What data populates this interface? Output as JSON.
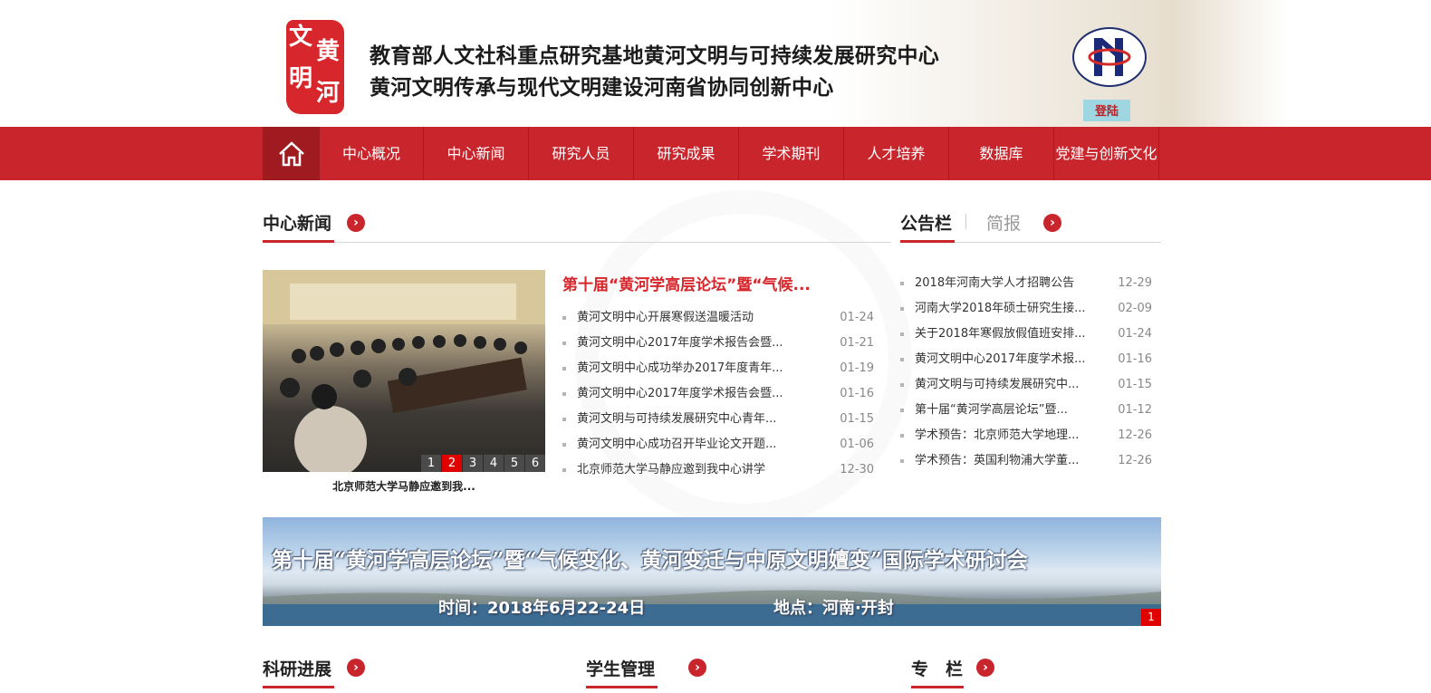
{
  "header": {
    "seal_chars": [
      "文",
      "黄",
      "明",
      "河"
    ],
    "title_line1": "教育部人文社科重点研究基地黄河文明与可持续发展研究中心",
    "title_line2": "黄河文明传承与现代文明建设河南省协同创新中心",
    "login_label": "登陆"
  },
  "nav": {
    "items": [
      "中心概况",
      "中心新闻",
      "研究人员",
      "研究成果",
      "学术期刊",
      "人才培养",
      "数据库",
      "党建与创新文化"
    ]
  },
  "news": {
    "title": "中心新闻",
    "headline": "第十届“黄河学高层论坛”暨“气候...",
    "pager": [
      "1",
      "2",
      "3",
      "4",
      "5",
      "6"
    ],
    "active_page": "2",
    "photo_caption": "北京师范大学马静应邀到我...",
    "items": [
      {
        "title": "黄河文明中心开展寒假送温暖活动",
        "date": "01-24"
      },
      {
        "title": "黄河文明中心2017年度学术报告会暨...",
        "date": "01-21"
      },
      {
        "title": "黄河文明中心成功举办2017年度青年...",
        "date": "01-19"
      },
      {
        "title": "黄河文明中心2017年度学术报告会暨...",
        "date": "01-16"
      },
      {
        "title": "黄河文明与可持续发展研究中心青年...",
        "date": "01-15"
      },
      {
        "title": "黄河文明中心成功召开毕业论文开题...",
        "date": "01-06"
      },
      {
        "title": "北京师范大学马静应邀到我中心讲学",
        "date": "12-30"
      }
    ]
  },
  "notice": {
    "tab_active": "公告栏",
    "tab_inactive": "简报",
    "items": [
      {
        "title": "2018年河南大学人才招聘公告",
        "date": "12-29"
      },
      {
        "title": "河南大学2018年硕士研究生接...",
        "date": "02-09"
      },
      {
        "title": "关于2018年寒假放假值班安排...",
        "date": "01-24"
      },
      {
        "title": "黄河文明中心2017年度学术报...",
        "date": "01-16"
      },
      {
        "title": "黄河文明与可持续发展研究中...",
        "date": "01-15"
      },
      {
        "title": "第十届“黄河学高层论坛”暨...",
        "date": "01-12"
      },
      {
        "title": "学术预告：北京师范大学地理...",
        "date": "12-26"
      },
      {
        "title": "学术预告：英国利物浦大学董...",
        "date": "12-26"
      }
    ]
  },
  "banner": {
    "title": "第十届“黄河学高层论坛”暨“气候变化、黄河变迁与中原文明嬗变”国际学术研讨会",
    "time": "时间：2018年6月22-24日",
    "place": "地点：河南·开封",
    "page": "1"
  },
  "bottom_sections": [
    "科研进展",
    "学生管理",
    "专　栏"
  ],
  "colors": {
    "brand_red": "#c8252c",
    "dark_red": "#9f1b20",
    "accent_red": "#e00000"
  }
}
